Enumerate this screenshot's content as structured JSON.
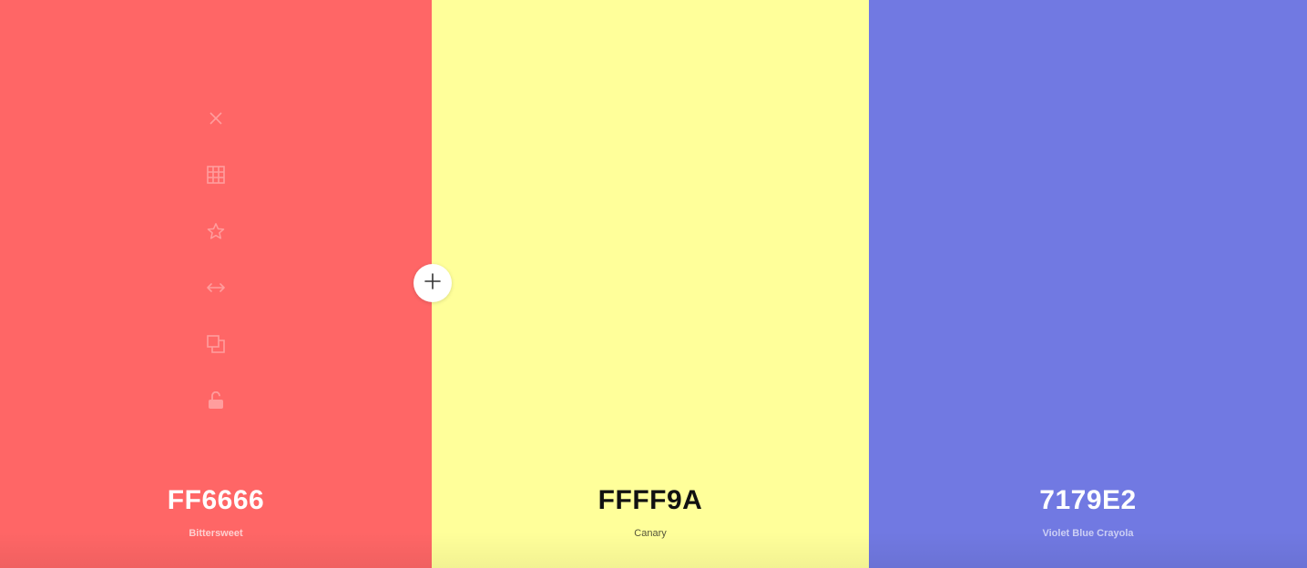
{
  "colors": [
    {
      "hex": "FF6666",
      "name": "Bittersweet",
      "background": "#FF6666",
      "text_color": "#FFFFFF",
      "name_color": "#FFD0D0"
    },
    {
      "hex": "FFFF9A",
      "name": "Canary",
      "background": "#FFFF9A",
      "text_color": "#111111",
      "name_color": "#55553A"
    },
    {
      "hex": "7179E2",
      "name": "Violet Blue Crayola",
      "background": "#7179E2",
      "text_color": "#FFFFFF",
      "name_color": "#CDD0F5"
    }
  ],
  "toolbar_icons": [
    "close-icon",
    "grid-icon",
    "star-icon",
    "arrows-horizontal-icon",
    "copy-icon",
    "unlock-icon"
  ],
  "add_button_icon": "plus-icon"
}
